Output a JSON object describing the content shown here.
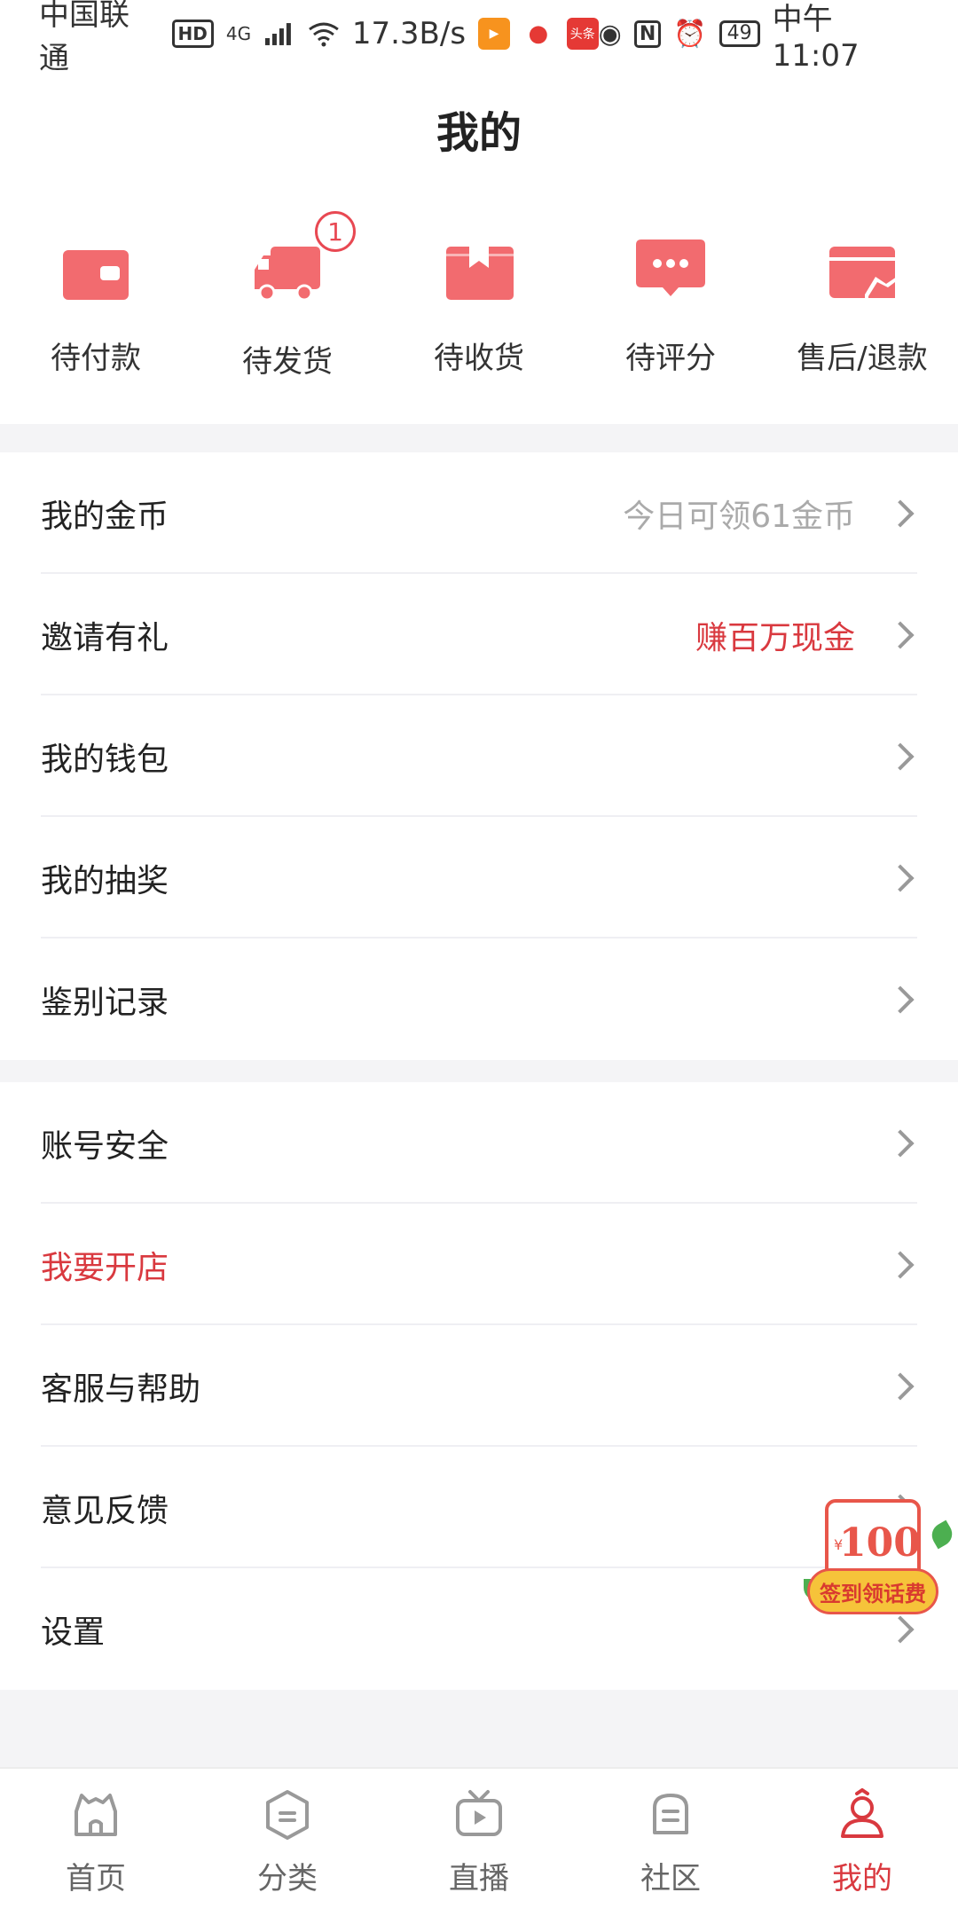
{
  "status_bar": {
    "carrier": "中国联通",
    "hd": "HD",
    "network": "4G",
    "speed": "17.3B/s",
    "app_badge": "头条",
    "battery": "49",
    "time": "中午11:07"
  },
  "header": {
    "title": "我的"
  },
  "orders": {
    "items": [
      {
        "label": "待付款",
        "icon": "wallet-icon"
      },
      {
        "label": "待发货",
        "icon": "truck-icon",
        "badge": "1"
      },
      {
        "label": "待收货",
        "icon": "box-icon"
      },
      {
        "label": "待评分",
        "icon": "chat-bubble-icon"
      },
      {
        "label": "售后/退款",
        "icon": "refund-card-icon"
      }
    ]
  },
  "menu1": {
    "items": [
      {
        "label": "我的金币",
        "extra": "今日可领61金币"
      },
      {
        "label": "邀请有礼",
        "extra": "赚百万现金"
      },
      {
        "label": "我的钱包"
      },
      {
        "label": "我的抽奖"
      },
      {
        "label": "鉴别记录"
      }
    ]
  },
  "menu2": {
    "items": [
      {
        "label": "账号安全"
      },
      {
        "label": "我要开店"
      },
      {
        "label": "客服与帮助"
      },
      {
        "label": "意见反馈"
      },
      {
        "label": "设置"
      }
    ]
  },
  "float_badge": {
    "amount": "100",
    "currency": "¥",
    "text": "签到领话费"
  },
  "bottom_nav": {
    "items": [
      {
        "label": "首页",
        "icon": "home-icon"
      },
      {
        "label": "分类",
        "icon": "category-icon"
      },
      {
        "label": "直播",
        "icon": "live-tv-icon"
      },
      {
        "label": "社区",
        "icon": "community-icon"
      },
      {
        "label": "我的",
        "icon": "profile-icon",
        "active": true
      }
    ]
  },
  "colors": {
    "accent": "#d9393f",
    "icon_red": "#f26b6f",
    "bg_gray": "#f4f4f6"
  }
}
